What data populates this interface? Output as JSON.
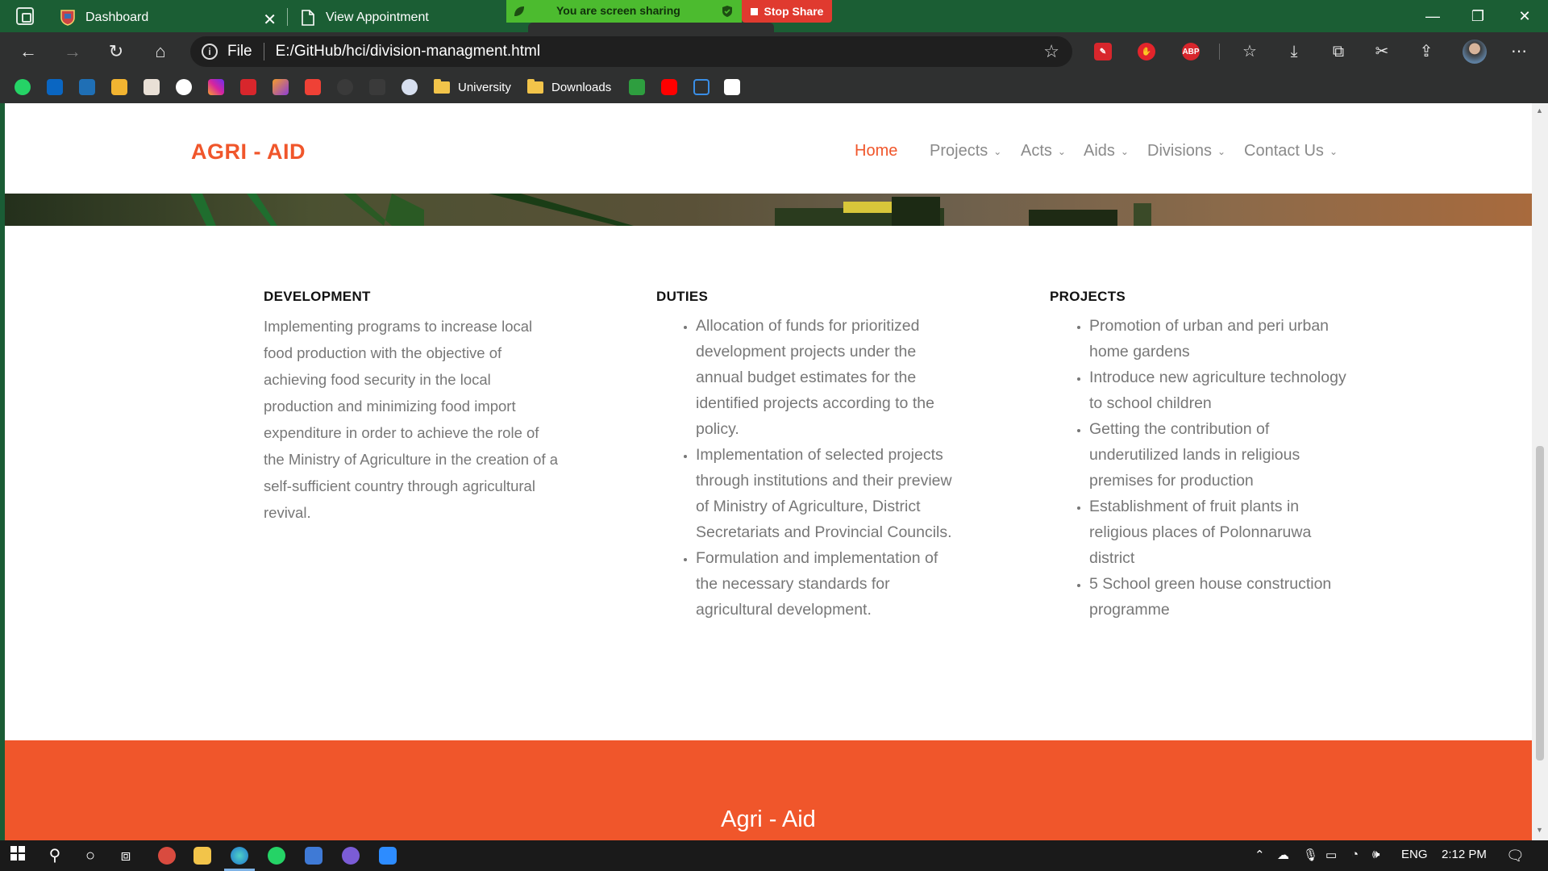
{
  "browser": {
    "tabs": [
      {
        "label": "Dashboard",
        "favicon": "shield-crest-icon"
      },
      {
        "label": "View Appointment",
        "favicon": "page-icon"
      }
    ],
    "sharing": {
      "text": "You are screen sharing",
      "stop_label": "Stop Share"
    },
    "address": {
      "protocol_label": "File",
      "url": "E:/GitHub/hci/division-managment.html"
    },
    "extensions": [
      "pen-extension-icon",
      "hand-extension-icon",
      "ABP"
    ],
    "bookmarks": [
      {
        "label": "University",
        "icon": "folder-icon"
      },
      {
        "label": "Downloads",
        "icon": "folder-icon"
      }
    ],
    "colors": {
      "tab_bar": "#1b5e34",
      "toolbar": "#2f3030",
      "share_green": "#4cbb2f",
      "stop_red": "#e03a2f"
    }
  },
  "site": {
    "logo": "AGRI - AID",
    "nav": [
      {
        "label": "Home",
        "active": true
      },
      {
        "label": "Projects",
        "dropdown": true
      },
      {
        "label": "Acts",
        "dropdown": true
      },
      {
        "label": "Aids",
        "dropdown": true
      },
      {
        "label": "Divisions",
        "dropdown": true
      },
      {
        "label": "Contact Us",
        "dropdown": true
      }
    ],
    "sections": {
      "development": {
        "title": "DEVELOPMENT",
        "text": "Implementing programs to increase local food production with the objective of achieving food security in the local production and minimizing food import expenditure in order to achieve the role of the Ministry of Agriculture in the creation of a self-sufficient country through agricultural revival."
      },
      "duties": {
        "title": "DUTIES",
        "items": [
          "Allocation of funds for prioritized development projects under the annual budget estimates for the identified projects according to the policy.",
          "Implementation of selected projects through institutions and their preview of Ministry of Agriculture, District Secretariats and Provincial Councils.",
          "Formulation and implementation of the necessary standards for agricultural development."
        ]
      },
      "projects": {
        "title": "PROJECTS",
        "items": [
          "Promotion of urban and peri urban home gardens",
          "Introduce new agriculture technology to school children",
          "Getting the contribution of underutilized lands in religious premises for production",
          "Establishment of fruit plants in religious places of Polonnaruwa district",
          "5 School green house construction programme"
        ]
      }
    },
    "footer_title": "Agri - Aid",
    "colors": {
      "accent": "#f0562b",
      "text_gray": "#777777"
    }
  },
  "taskbar": {
    "language": "ENG",
    "time": "2:12 PM"
  }
}
